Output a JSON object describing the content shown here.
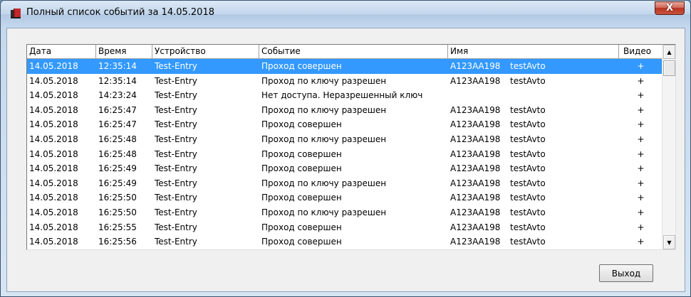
{
  "window": {
    "title": "Полный список событий за 14.05.2018",
    "close_glyph": "X"
  },
  "table": {
    "headers": {
      "date": "Дата",
      "time": "Время",
      "device": "Устройство",
      "event": "Событие",
      "name": "Имя",
      "video": "Видео"
    },
    "rows": [
      {
        "date": "14.05.2018",
        "time": "12:35:14",
        "device": "Test-Entry",
        "event": "Проход совершен",
        "plate": "А123АА198",
        "owner": "testAvto",
        "video": "+",
        "selected": true
      },
      {
        "date": "14.05.2018",
        "time": "12:35:14",
        "device": "Test-Entry",
        "event": "Проход по ключу разрешен",
        "plate": "А123АА198",
        "owner": "testAvto",
        "video": "+"
      },
      {
        "date": "14.05.2018",
        "time": "14:23:24",
        "device": "Test-Entry",
        "event": "Нет доступа. Неразрешенный ключ",
        "plate": "",
        "owner": "",
        "video": "+"
      },
      {
        "date": "14.05.2018",
        "time": "16:25:47",
        "device": "Test-Entry",
        "event": "Проход по ключу разрешен",
        "plate": "А123АА198",
        "owner": "testAvto",
        "video": "+"
      },
      {
        "date": "14.05.2018",
        "time": "16:25:47",
        "device": "Test-Entry",
        "event": "Проход совершен",
        "plate": "А123АА198",
        "owner": "testAvto",
        "video": "+"
      },
      {
        "date": "14.05.2018",
        "time": "16:25:48",
        "device": "Test-Entry",
        "event": "Проход по ключу разрешен",
        "plate": "А123АА198",
        "owner": "testAvto",
        "video": "+"
      },
      {
        "date": "14.05.2018",
        "time": "16:25:48",
        "device": "Test-Entry",
        "event": "Проход совершен",
        "plate": "А123АА198",
        "owner": "testAvto",
        "video": "+"
      },
      {
        "date": "14.05.2018",
        "time": "16:25:49",
        "device": "Test-Entry",
        "event": "Проход совершен",
        "plate": "А123АА198",
        "owner": "testAvto",
        "video": "+"
      },
      {
        "date": "14.05.2018",
        "time": "16:25:49",
        "device": "Test-Entry",
        "event": "Проход по ключу разрешен",
        "plate": "А123АА198",
        "owner": "testAvto",
        "video": "+"
      },
      {
        "date": "14.05.2018",
        "time": "16:25:50",
        "device": "Test-Entry",
        "event": "Проход совершен",
        "plate": "А123АА198",
        "owner": "testAvto",
        "video": "+"
      },
      {
        "date": "14.05.2018",
        "time": "16:25:50",
        "device": "Test-Entry",
        "event": "Проход по ключу разрешен",
        "plate": "А123АА198",
        "owner": "testAvto",
        "video": "+"
      },
      {
        "date": "14.05.2018",
        "time": "16:25:55",
        "device": "Test-Entry",
        "event": "Проход совершен",
        "plate": "А123АА198",
        "owner": "testAvto",
        "video": "+"
      },
      {
        "date": "14.05.2018",
        "time": "16:25:56",
        "device": "Test-Entry",
        "event": "Проход совершен",
        "plate": "А123АА198",
        "owner": "testAvto",
        "video": "+"
      }
    ]
  },
  "scrollbar": {
    "up_glyph": "▲",
    "down_glyph": "▼"
  },
  "buttons": {
    "exit_label": "Выход"
  },
  "colors": {
    "selection": "#3399ff",
    "close_button": "#c9553d",
    "icon": "#c0282c"
  },
  "icons": {
    "app": "book-icon"
  }
}
